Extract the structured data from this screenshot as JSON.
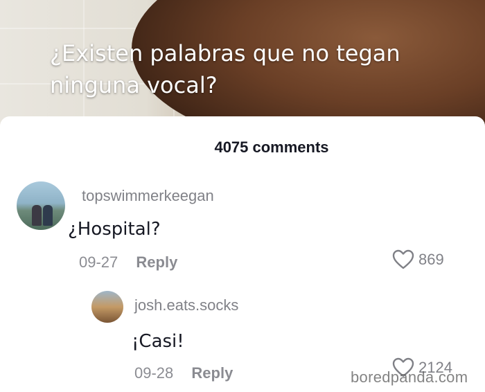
{
  "video": {
    "caption": "¿Existen palabras que no tegan ninguna vocal?"
  },
  "comments_panel": {
    "count_label": "4075 comments",
    "comments": [
      {
        "username": "topswimmerkeegan",
        "text": "¿Hospital?",
        "date": "09-27",
        "reply_label": "Reply",
        "likes": "869"
      },
      {
        "username": "josh.eats.socks",
        "text": "¡Casi!",
        "date": "09-28",
        "reply_label": "Reply",
        "likes": "2124"
      }
    ]
  },
  "icons": {
    "like": "heart-outline-icon"
  },
  "watermark": "boredpanda.com"
}
